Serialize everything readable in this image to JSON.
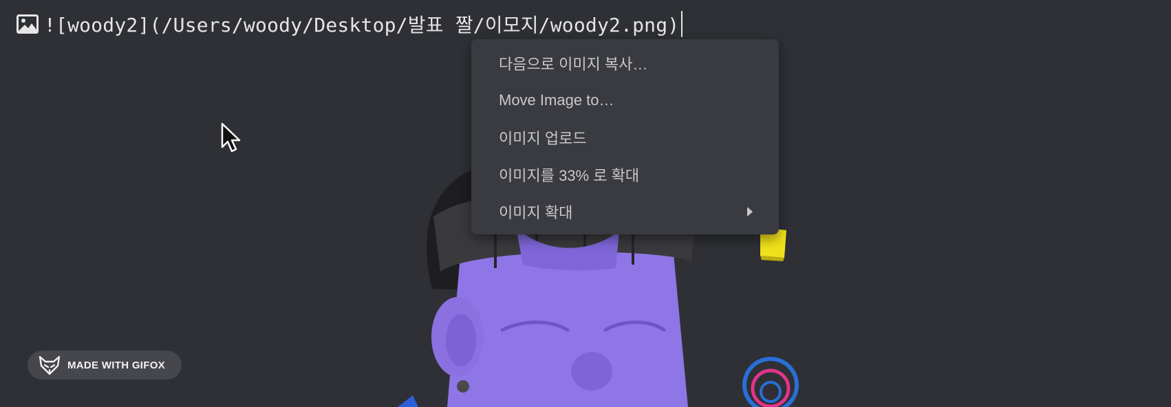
{
  "editor": {
    "markdown_text": "![woody2](/Users/woody/Desktop/발표 짤/이모지/woody2.png)"
  },
  "context_menu": {
    "items": [
      {
        "label": "다음으로 이미지 복사…",
        "has_submenu": false
      },
      {
        "label": "Move Image to…",
        "has_submenu": false
      },
      {
        "label": "이미지 업로드",
        "has_submenu": false
      },
      {
        "label": "이미지를 33% 로 확대",
        "has_submenu": false
      },
      {
        "label": "이미지 확대",
        "has_submenu": true
      }
    ]
  },
  "watermark": {
    "text": "MADE WITH GIFOX"
  },
  "colors": {
    "background": "#2e3035",
    "menu_background": "#3a3b40",
    "menu_text": "#c9c9cc",
    "skin": "#8f76e6"
  },
  "icons": {
    "image": "image-icon",
    "submenu": "chevron-right-icon",
    "cursor": "mouse-pointer-icon",
    "logo": "fox-logo-icon"
  }
}
